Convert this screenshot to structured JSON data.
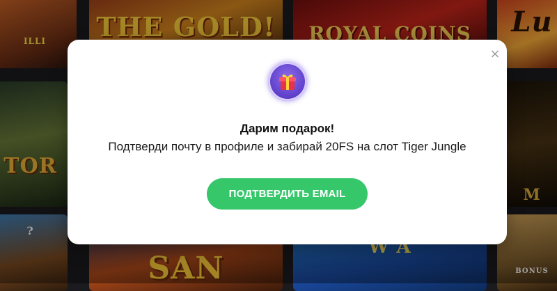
{
  "background_tiles": [
    {
      "title": "ILLI"
    },
    {
      "title": "THE GOLD!"
    },
    {
      "title": "ROYAL COINS"
    },
    {
      "title": "Lu"
    },
    {
      "title": "TOR"
    },
    {
      "title": "M"
    },
    {
      "title": "?"
    },
    {
      "title": "SAN"
    },
    {
      "title": "W A"
    },
    {
      "title": "BONUS"
    }
  ],
  "modal": {
    "close_icon": "×",
    "gift_icon": "gift-icon",
    "heading": "Дарим подарок!",
    "description": "Подтверди почту в профиле и забирай 20FS на слот Tiger Jungle",
    "cta_label": "ПОДТВЕРДИТЬ EMAIL"
  },
  "colors": {
    "accent": "#36c76b",
    "gift_bg": "#5a3bc7",
    "gift_box": "#e8324a"
  }
}
